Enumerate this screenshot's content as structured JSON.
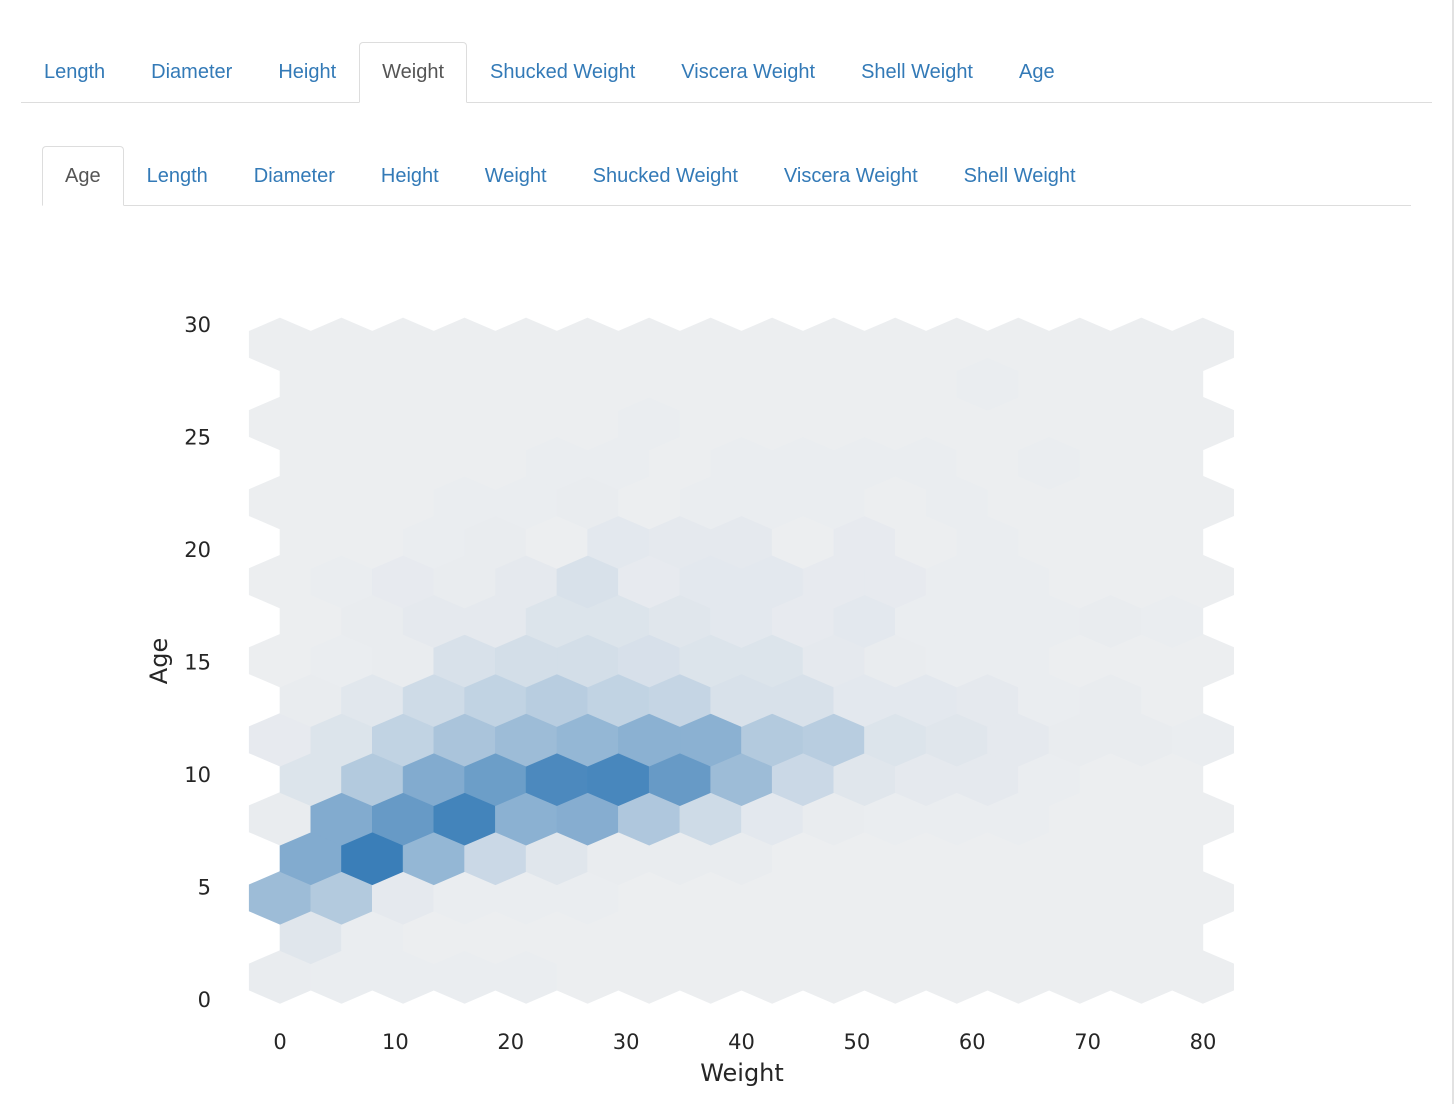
{
  "top_tabs": {
    "active_index": 3,
    "items": [
      "Length",
      "Diameter",
      "Height",
      "Weight",
      "Shucked Weight",
      "Viscera Weight",
      "Shell Weight",
      "Age"
    ]
  },
  "sub_tabs": {
    "active_index": 0,
    "items": [
      "Age",
      "Length",
      "Diameter",
      "Height",
      "Weight",
      "Shucked Weight",
      "Viscera Weight",
      "Shell Weight"
    ]
  },
  "colors": {
    "link": "#337ab7",
    "active_tab_text": "#555555",
    "hex_low": "#eeeff1",
    "hex_high": "#3a7eb8"
  },
  "chart_data": {
    "type": "heatmap",
    "subtype": "hexbin",
    "title": "",
    "xlabel": "Weight",
    "ylabel": "Age",
    "xlim": [
      -2.7,
      82.7
    ],
    "ylim": [
      -0.5,
      30.5
    ],
    "x_ticks": [
      0,
      10,
      20,
      30,
      40,
      50,
      60,
      70,
      80
    ],
    "y_ticks": [
      0,
      5,
      10,
      15,
      20,
      25,
      30
    ],
    "grid": false,
    "legend": "none",
    "hex_x_step": 5.333,
    "hex_row_y_start": 0.98,
    "hex_row_y_step": 1.757,
    "hex_even_row_x_start": 0,
    "hex_odd_row_x_start": 2.667,
    "density_rows_bottom_to_top": [
      [
        0.03,
        0.02,
        0.02,
        0.02,
        0.02,
        0.01,
        0.01,
        0.01,
        0.01,
        0.01,
        0.01,
        0.01,
        0.01,
        0.01,
        0.01,
        0.01
      ],
      [
        0.08,
        0.02,
        0.01,
        0.01,
        0.01,
        0.01,
        0.01,
        0.01,
        0.01,
        0.01,
        0.01,
        0.01,
        0.01,
        0.01,
        0.01
      ],
      [
        0.45,
        0.33,
        0.05,
        0.02,
        0.02,
        0.02,
        0.01,
        0.01,
        0.01,
        0.01,
        0.01,
        0.01,
        0.01,
        0.01,
        0.01,
        0.01
      ],
      [
        0.6,
        1.0,
        0.5,
        0.2,
        0.08,
        0.03,
        0.03,
        0.03,
        0.01,
        0.01,
        0.01,
        0.01,
        0.01,
        0.01,
        0.01
      ],
      [
        0.03,
        0.6,
        0.75,
        0.95,
        0.55,
        0.58,
        0.35,
        0.18,
        0.06,
        0.03,
        0.02,
        0.02,
        0.02,
        0.01,
        0.01,
        0.01
      ],
      [
        0.1,
        0.33,
        0.6,
        0.72,
        0.9,
        0.92,
        0.75,
        0.45,
        0.2,
        0.08,
        0.05,
        0.05,
        0.02,
        0.01,
        0.01
      ],
      [
        0.04,
        0.1,
        0.25,
        0.38,
        0.45,
        0.5,
        0.55,
        0.55,
        0.33,
        0.3,
        0.1,
        0.08,
        0.05,
        0.03,
        0.03,
        0.02
      ],
      [
        0.03,
        0.07,
        0.18,
        0.25,
        0.3,
        0.25,
        0.23,
        0.12,
        0.12,
        0.06,
        0.06,
        0.05,
        0.02,
        0.03,
        0.01
      ],
      [
        0.01,
        0.02,
        0.03,
        0.12,
        0.15,
        0.15,
        0.13,
        0.1,
        0.1,
        0.05,
        0.03,
        0.02,
        0.02,
        0.01,
        0.01,
        0.01
      ],
      [
        0.01,
        0.03,
        0.05,
        0.05,
        0.1,
        0.1,
        0.08,
        0.06,
        0.04,
        0.06,
        0.02,
        0.02,
        0.02,
        0.03,
        0.02
      ],
      [
        0.01,
        0.02,
        0.04,
        0.03,
        0.05,
        0.12,
        0.04,
        0.06,
        0.06,
        0.04,
        0.04,
        0.02,
        0.02,
        0.01,
        0.01,
        0.01
      ],
      [
        0.01,
        0.01,
        0.02,
        0.03,
        0.01,
        0.06,
        0.05,
        0.05,
        0.01,
        0.04,
        0.01,
        0.02,
        0.01,
        0.01,
        0.01
      ],
      [
        0.01,
        0.01,
        0.01,
        0.02,
        0.02,
        0.03,
        0.01,
        0.02,
        0.02,
        0.02,
        0.01,
        0.02,
        0.01,
        0.01,
        0.01,
        0.01
      ],
      [
        0.01,
        0.01,
        0.01,
        0.01,
        0.02,
        0.02,
        0.01,
        0.02,
        0.02,
        0.02,
        0.02,
        0.01,
        0.02,
        0.01,
        0.01
      ],
      [
        0.01,
        0.01,
        0.01,
        0.01,
        0.01,
        0.01,
        0.02,
        0.01,
        0.01,
        0.01,
        0.01,
        0.01,
        0.01,
        0.01,
        0.01,
        0.01
      ],
      [
        0.01,
        0.01,
        0.01,
        0.01,
        0.01,
        0.01,
        0.01,
        0.01,
        0.01,
        0.01,
        0.01,
        0.02,
        0.01,
        0.01,
        0.01
      ],
      [
        0.01,
        0.01,
        0.01,
        0.01,
        0.01,
        0.01,
        0.01,
        0.01,
        0.01,
        0.01,
        0.01,
        0.01,
        0.01,
        0.01,
        0.01,
        0.01
      ]
    ]
  }
}
